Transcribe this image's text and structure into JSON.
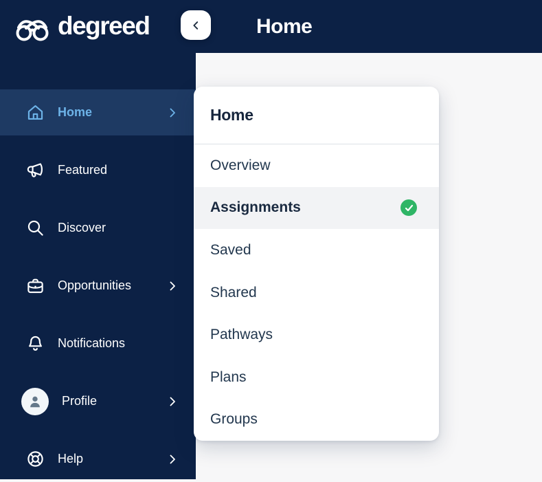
{
  "colors": {
    "navy": "#0C2145",
    "sidebar_active_bg": "#1E3A63",
    "accent_blue": "#6DB3E8",
    "content_bg": "#F7F7F8",
    "panel_bg": "#FFFFFF",
    "selected_row_bg": "#F2F3F5",
    "success_green": "#2FB566",
    "divider": "#DDE1E6",
    "text_dark": "#16253C"
  },
  "logo": {
    "text": "degreed",
    "icon": "degreed-glasses-icon"
  },
  "topbar": {
    "title": "Home"
  },
  "collapse_button": {
    "icon": "chevron-left-icon"
  },
  "sidebar": {
    "items": [
      {
        "label": "Home",
        "icon": "home-icon",
        "has_chevron": true,
        "active": true
      },
      {
        "label": "Featured",
        "icon": "megaphone-icon",
        "has_chevron": false,
        "active": false
      },
      {
        "label": "Discover",
        "icon": "search-icon",
        "has_chevron": false,
        "active": false
      },
      {
        "label": "Opportunities",
        "icon": "briefcase-icon",
        "has_chevron": true,
        "active": false
      },
      {
        "label": "Notifications",
        "icon": "bell-icon",
        "has_chevron": false,
        "active": false
      },
      {
        "label": "Profile",
        "icon": "avatar-icon",
        "has_chevron": true,
        "active": false
      },
      {
        "label": "Help",
        "icon": "life-buoy-icon",
        "has_chevron": true,
        "active": false
      }
    ]
  },
  "flyout": {
    "title": "Home",
    "items": [
      {
        "label": "Overview",
        "selected": false
      },
      {
        "label": "Assignments",
        "selected": true,
        "badge": "check-icon"
      },
      {
        "label": "Saved",
        "selected": false
      },
      {
        "label": "Shared",
        "selected": false
      },
      {
        "label": "Pathways",
        "selected": false
      },
      {
        "label": "Plans",
        "selected": false
      },
      {
        "label": "Groups",
        "selected": false
      }
    ]
  }
}
